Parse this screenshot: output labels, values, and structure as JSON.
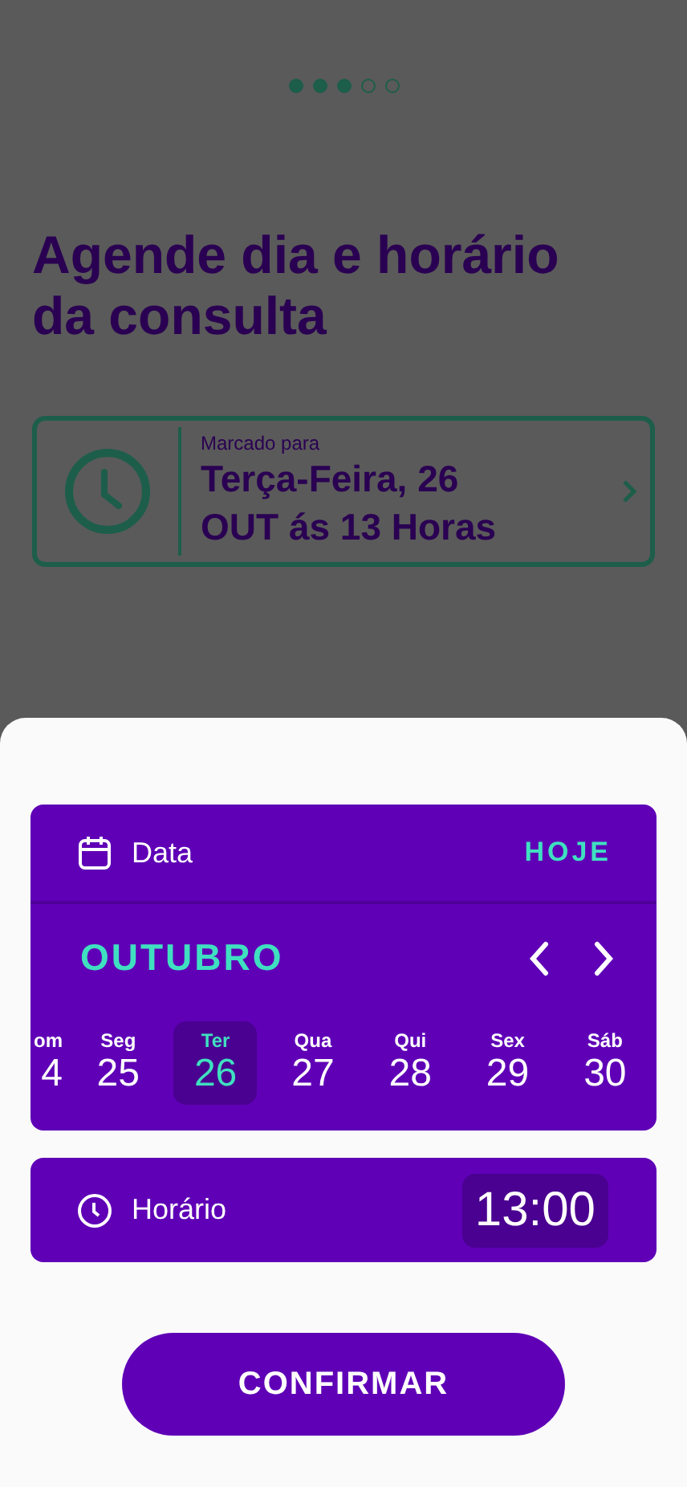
{
  "steps": [
    {
      "done": true
    },
    {
      "done": true
    },
    {
      "done": true
    },
    {
      "done": false
    },
    {
      "done": false
    }
  ],
  "title": "Agende dia e horário da consulta",
  "appointment": {
    "label": "Marcado para",
    "line_1": "Terça-Feira, 26",
    "line_2": "OUT ás 13 Horas"
  },
  "date_panel": {
    "label": "Data",
    "today_button": "HOJE",
    "month": "OUTUBRO",
    "days": [
      {
        "weekday": "om",
        "day": "4",
        "selected": false
      },
      {
        "weekday": "Seg",
        "day": "25",
        "selected": false
      },
      {
        "weekday": "Ter",
        "day": "26",
        "selected": true
      },
      {
        "weekday": "Qua",
        "day": "27",
        "selected": false
      },
      {
        "weekday": "Qui",
        "day": "28",
        "selected": false
      },
      {
        "weekday": "Sex",
        "day": "29",
        "selected": false
      },
      {
        "weekday": "Sáb",
        "day": "30",
        "selected": false
      }
    ]
  },
  "time_panel": {
    "label": "Horário",
    "value": "13:00"
  },
  "confirm_button": "CONFIRMAR"
}
